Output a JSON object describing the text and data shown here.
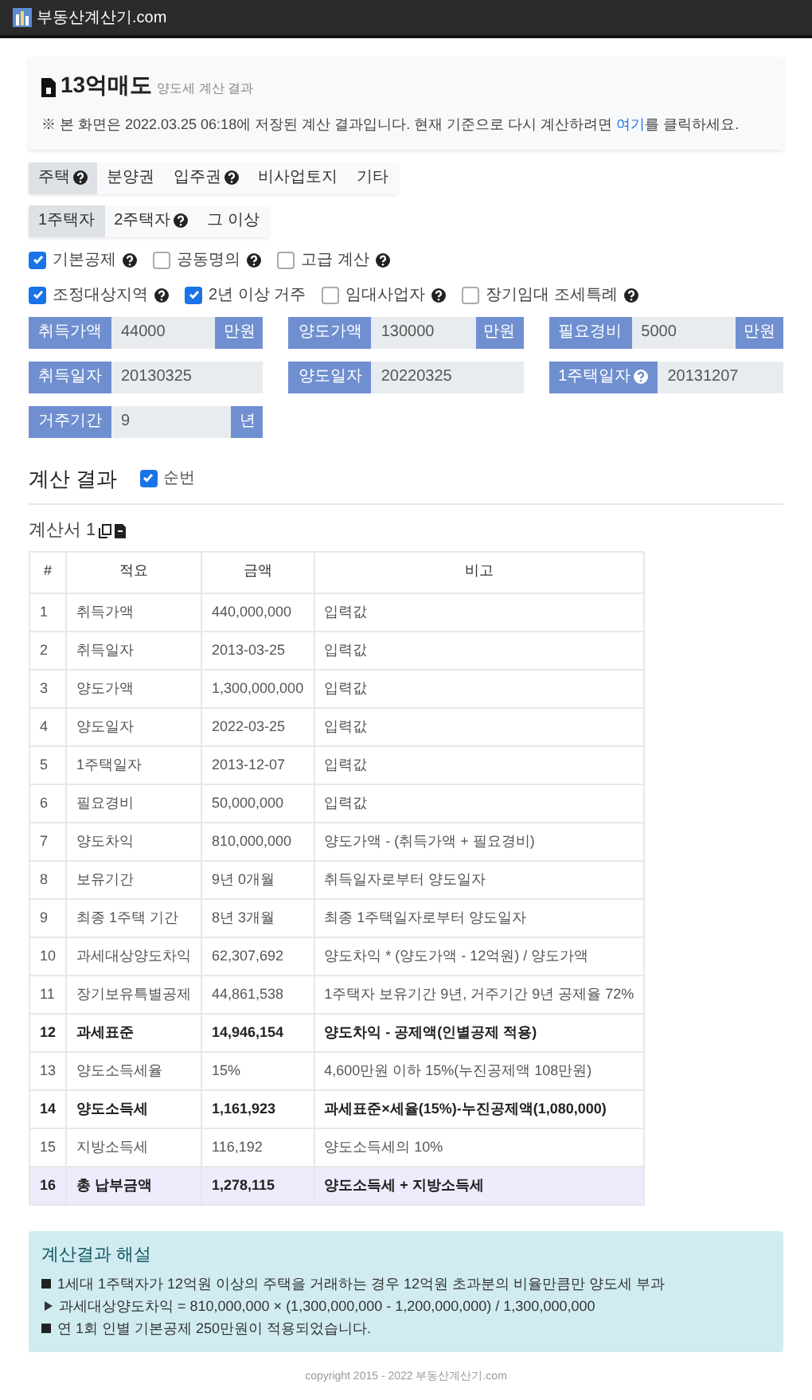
{
  "site": {
    "title": "부동산계산기.com"
  },
  "header_card": {
    "title": "13억매도",
    "subtitle": "양도세 계산 결과",
    "notice_before": "※ 본 화면은 2022.03.25 06:18에 저장된 계산 결과입니다. 현재 기준으로 다시 계산하려면 ",
    "notice_link": "여기",
    "notice_after": "를 클릭하세요."
  },
  "tabs": [
    {
      "label": "주택",
      "help": true,
      "selected": true
    },
    {
      "label": "분양권",
      "help": false,
      "selected": false
    },
    {
      "label": "입주권",
      "help": true,
      "selected": false
    },
    {
      "label": "비사업토지",
      "help": false,
      "selected": false
    },
    {
      "label": "기타",
      "help": false,
      "selected": false
    }
  ],
  "subtabs": [
    {
      "label": "1주택자",
      "help": false,
      "selected": true
    },
    {
      "label": "2주택자",
      "help": true,
      "selected": false
    },
    {
      "label": "그 이상",
      "help": false,
      "selected": false
    }
  ],
  "options": [
    [
      {
        "label": "기본공제",
        "help": true,
        "checked": true
      },
      {
        "label": "공동명의",
        "help": true,
        "checked": false
      },
      {
        "label": "고급 계산",
        "help": true,
        "checked": false
      }
    ],
    [
      {
        "label": "조정대상지역",
        "help": true,
        "checked": true
      },
      {
        "label": "2년 이상 거주",
        "help": false,
        "checked": true
      },
      {
        "label": "임대사업자",
        "help": true,
        "checked": false
      },
      {
        "label": "장기임대 조세특례",
        "help": true,
        "checked": false
      }
    ]
  ],
  "fields": [
    {
      "label": "취득가액",
      "value": "44000",
      "unit": "만원",
      "help": false
    },
    {
      "label": "양도가액",
      "value": "130000",
      "unit": "만원",
      "help": false
    },
    {
      "label": "필요경비",
      "value": "5000",
      "unit": "만원",
      "help": false
    },
    {
      "label": "취득일자",
      "value": "20130325",
      "help": false
    },
    {
      "label": "양도일자",
      "value": "20220325",
      "help": false
    },
    {
      "label": "1주택일자",
      "value": "20131207",
      "help": true
    },
    {
      "label": "거주기간",
      "value": "9",
      "unit": "년",
      "help": false
    }
  ],
  "results": {
    "title": "계산 결과",
    "numbering": {
      "label": "순번",
      "checked": true
    }
  },
  "statement": {
    "title": "계산서 1"
  },
  "table": {
    "columns": [
      "#",
      "적요",
      "금액",
      "비고"
    ],
    "rows": [
      {
        "cells": [
          "1",
          "취득가액",
          "440,000,000",
          "입력값"
        ],
        "bold": false,
        "highlighted": false
      },
      {
        "cells": [
          "2",
          "취득일자",
          "2013-03-25",
          "입력값"
        ],
        "bold": false,
        "highlighted": false
      },
      {
        "cells": [
          "3",
          "양도가액",
          "1,300,000,000",
          "입력값"
        ],
        "bold": false,
        "highlighted": false
      },
      {
        "cells": [
          "4",
          "양도일자",
          "2022-03-25",
          "입력값"
        ],
        "bold": false,
        "highlighted": false
      },
      {
        "cells": [
          "5",
          "1주택일자",
          "2013-12-07",
          "입력값"
        ],
        "bold": false,
        "highlighted": false
      },
      {
        "cells": [
          "6",
          "필요경비",
          "50,000,000",
          "입력값"
        ],
        "bold": false,
        "highlighted": false
      },
      {
        "cells": [
          "7",
          "양도차익",
          "810,000,000",
          "양도가액 - (취득가액 + 필요경비)"
        ],
        "bold": false,
        "highlighted": false
      },
      {
        "cells": [
          "8",
          "보유기간",
          "9년 0개월",
          "취득일자로부터 양도일자"
        ],
        "bold": false,
        "highlighted": false
      },
      {
        "cells": [
          "9",
          "최종 1주택 기간",
          "8년 3개월",
          "최종 1주택일자로부터 양도일자"
        ],
        "bold": false,
        "highlighted": false
      },
      {
        "cells": [
          "10",
          "과세대상양도차익",
          "62,307,692",
          "양도차익 * (양도가액 - 12억원) / 양도가액"
        ],
        "bold": false,
        "highlighted": false
      },
      {
        "cells": [
          "11",
          "장기보유특별공제",
          "44,861,538",
          "1주택자 보유기간 9년, 거주기간 9년 공제율 72%"
        ],
        "bold": false,
        "highlighted": false
      },
      {
        "cells": [
          "12",
          "과세표준",
          "14,946,154",
          "양도차익 - 공제액(인별공제 적용)"
        ],
        "bold": true,
        "highlighted": false
      },
      {
        "cells": [
          "13",
          "양도소득세율",
          "15%",
          "4,600만원 이하 15%(누진공제액 108만원)"
        ],
        "bold": false,
        "highlighted": false
      },
      {
        "cells": [
          "14",
          "양도소득세",
          "1,161,923",
          "과세표준×세율(15%)-누진공제액(1,080,000)"
        ],
        "bold": true,
        "highlighted": false
      },
      {
        "cells": [
          "15",
          "지방소득세",
          "116,192",
          "양도소득세의 10%"
        ],
        "bold": false,
        "highlighted": false
      },
      {
        "cells": [
          "16",
          "총 납부금액",
          "1,278,115",
          "양도소득세 + 지방소득세"
        ],
        "bold": true,
        "highlighted": true
      }
    ]
  },
  "explanation": {
    "title": "계산결과 해설",
    "items": [
      {
        "kind": "square",
        "text": "1세대 1주택자가 12억원 이상의 주택을 거래하는 경우 12억원 초과분의 비율만큼만 양도세 부과"
      },
      {
        "kind": "arrow",
        "text": "과세대상양도차익 = 810,000,000 × (1,300,000,000 - 1,200,000,000) / 1,300,000,000"
      },
      {
        "kind": "square",
        "text": "연 1회 인별 기본공제 250만원이 적용되었습니다."
      }
    ]
  },
  "footer": "copyright 2015 - 2022 부동산계산기.com"
}
